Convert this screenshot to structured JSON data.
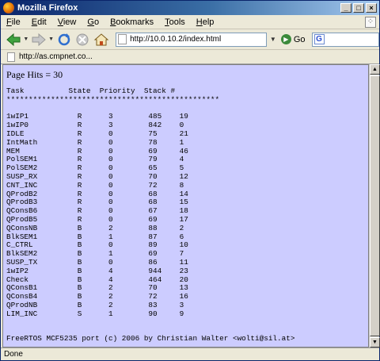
{
  "window": {
    "title": "Mozilla Firefox",
    "min_label": "_",
    "max_label": "□",
    "close_label": "×"
  },
  "menu": [
    {
      "accel": "F",
      "rest": "ile"
    },
    {
      "accel": "E",
      "rest": "dit"
    },
    {
      "accel": "V",
      "rest": "iew"
    },
    {
      "accel": "G",
      "rest": "o"
    },
    {
      "accel": "B",
      "rest": "ookmarks"
    },
    {
      "accel": "T",
      "rest": "ools"
    },
    {
      "accel": "H",
      "rest": "elp"
    }
  ],
  "navbar": {
    "url": "http://10.0.10.2/index.html",
    "go_label": "Go",
    "search_logo": "G"
  },
  "bookmarks_toolbar": {
    "item_label": "http://as.cmpnet.co..."
  },
  "page": {
    "hits_label": "Page Hits = 30",
    "table_header": "Task          State  Priority  Stack #",
    "separator": "************************************************",
    "rows": [
      [
        "1wIP1",
        "R",
        "3",
        "485",
        "19"
      ],
      [
        "1wIP0",
        "R",
        "3",
        "842",
        "0"
      ],
      [
        "IDLE",
        "R",
        "0",
        "75",
        "21"
      ],
      [
        "IntMath",
        "R",
        "0",
        "78",
        "1"
      ],
      [
        "MEM",
        "R",
        "0",
        "69",
        "46"
      ],
      [
        "PolSEM1",
        "R",
        "0",
        "79",
        "4"
      ],
      [
        "PolSEM2",
        "R",
        "0",
        "65",
        "5"
      ],
      [
        "SUSP_RX",
        "R",
        "0",
        "70",
        "12"
      ],
      [
        "CNT_INC",
        "R",
        "0",
        "72",
        "8"
      ],
      [
        "QProdB2",
        "R",
        "0",
        "68",
        "14"
      ],
      [
        "QProdB3",
        "R",
        "0",
        "68",
        "15"
      ],
      [
        "QConsB6",
        "R",
        "0",
        "67",
        "18"
      ],
      [
        "QProdB5",
        "R",
        "0",
        "69",
        "17"
      ],
      [
        "QConsNB",
        "B",
        "2",
        "88",
        "2"
      ],
      [
        "BlkSEM1",
        "B",
        "1",
        "87",
        "6"
      ],
      [
        "C_CTRL",
        "B",
        "0",
        "89",
        "10"
      ],
      [
        "BlkSEM2",
        "B",
        "1",
        "69",
        "7"
      ],
      [
        "SUSP_TX",
        "B",
        "0",
        "86",
        "11"
      ],
      [
        "1wIP2",
        "B",
        "4",
        "944",
        "23"
      ],
      [
        "Check",
        "B",
        "4",
        "464",
        "20"
      ],
      [
        "QConsB1",
        "B",
        "2",
        "70",
        "13"
      ],
      [
        "QConsB4",
        "B",
        "2",
        "72",
        "16"
      ],
      [
        "QProdNB",
        "B",
        "2",
        "83",
        "3"
      ],
      [
        "LIM_INC",
        "S",
        "1",
        "90",
        "9"
      ]
    ],
    "footer": "FreeRTOS MCF5235 port (c) 2006 by Christian Walter <wolti@sil.at>"
  },
  "status": {
    "text": "Done"
  }
}
